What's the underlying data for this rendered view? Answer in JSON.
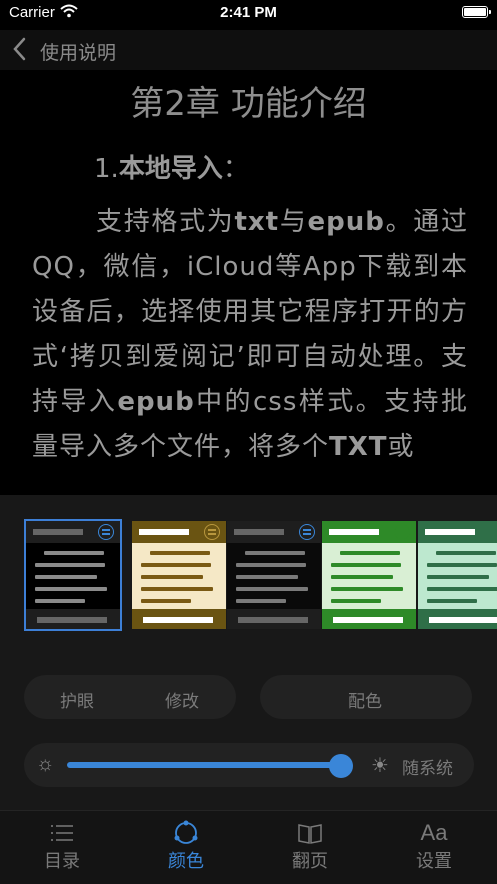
{
  "status": {
    "carrier": "Carrier",
    "time": "2:41 PM"
  },
  "nav": {
    "title": "使用说明"
  },
  "reader": {
    "chapter": "第2章 功能介绍",
    "section_num": "1.",
    "section_title": "本地导入",
    "section_colon": "：",
    "p1": "支持格式为",
    "b1": "txt",
    "p2": "与",
    "b2": "epub",
    "p3": "。通过QQ，微信，iCloud等App下载到本设备后，选择使用其它程序打开的方式‘拷贝到爱阅记’即可自动处理。支持导入",
    "b3": "epub",
    "p4": "中的css样式。支持批量导入多个文件，将多个",
    "b4": "TXT",
    "p5": "或"
  },
  "themes": [
    {
      "name": "black",
      "bg": "#000000",
      "line": "#8a8a8a",
      "accent": "#3a86d8",
      "selected": true
    },
    {
      "name": "parchment",
      "bg": "#f5e8c6",
      "line": "#7a5a14",
      "accent": "#b8973d",
      "selected": false
    },
    {
      "name": "dark-gray",
      "bg": "#0a0a0a",
      "line": "#7a7a7a",
      "accent": "#3a86d8",
      "selected": false
    },
    {
      "name": "green",
      "bg": "#d9efd4",
      "line": "#2e8a28",
      "accent": "#2e8a28",
      "selected": false
    },
    {
      "name": "mint",
      "bg": "#bde8cf",
      "line": "#2f6f48",
      "accent": "#2f6f48",
      "selected": false
    }
  ],
  "pills": {
    "eye_care": "护眼",
    "modify": "修改",
    "color_scheme": "配色"
  },
  "brightness": {
    "value": 0.95,
    "follow_system": "随系统"
  },
  "tabs": [
    {
      "label": "目录",
      "icon": "list-icon",
      "active": false
    },
    {
      "label": "颜色",
      "icon": "palette-icon",
      "active": true
    },
    {
      "label": "翻页",
      "icon": "book-icon",
      "active": false
    },
    {
      "label": "设置",
      "icon": "font-settings-icon",
      "active": false
    }
  ],
  "colors": {
    "accent": "#3a86d8"
  }
}
